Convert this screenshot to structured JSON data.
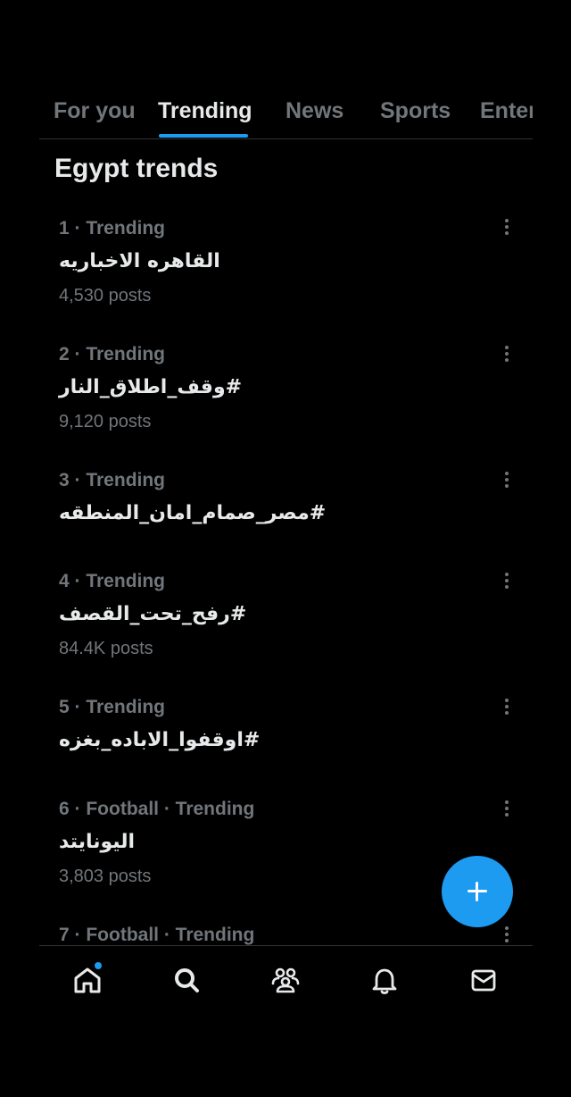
{
  "tabs": [
    {
      "label": "For you"
    },
    {
      "label": "Trending"
    },
    {
      "label": "News"
    },
    {
      "label": "Sports"
    },
    {
      "label": "Enter"
    }
  ],
  "heading": "Egypt trends",
  "trends": [
    {
      "meta": "1 · Trending",
      "name": "القاهره الاخباريه",
      "count": "4,530 posts"
    },
    {
      "meta": "2 · Trending",
      "name": "#وقف_اطلاق_النار",
      "count": "9,120 posts"
    },
    {
      "meta": "3 · Trending",
      "name": "#مصر_صمام_امان_المنطقه",
      "count": ""
    },
    {
      "meta": "4 · Trending",
      "name": "#رفح_تحت_القصف",
      "count": "84.4K posts"
    },
    {
      "meta": "5 · Trending",
      "name": "#اوقفوا_الاباده_بغزه",
      "count": ""
    },
    {
      "meta": "6 · Football · Trending",
      "name": "اليونايتد",
      "count": "3,803 posts"
    },
    {
      "meta": "7 · Football · Trending",
      "name": "",
      "count": ""
    }
  ],
  "icons": {
    "more": "more-vertical-icon",
    "compose": "plus-icon",
    "nav": [
      "home-icon",
      "search-icon",
      "communities-icon",
      "notifications-icon",
      "messages-icon"
    ]
  },
  "colors": {
    "background": "#000000",
    "accent": "#1d9bf0",
    "primary_text": "#e7e9ea",
    "secondary_text": "#71767b",
    "divider": "#2f3336"
  }
}
